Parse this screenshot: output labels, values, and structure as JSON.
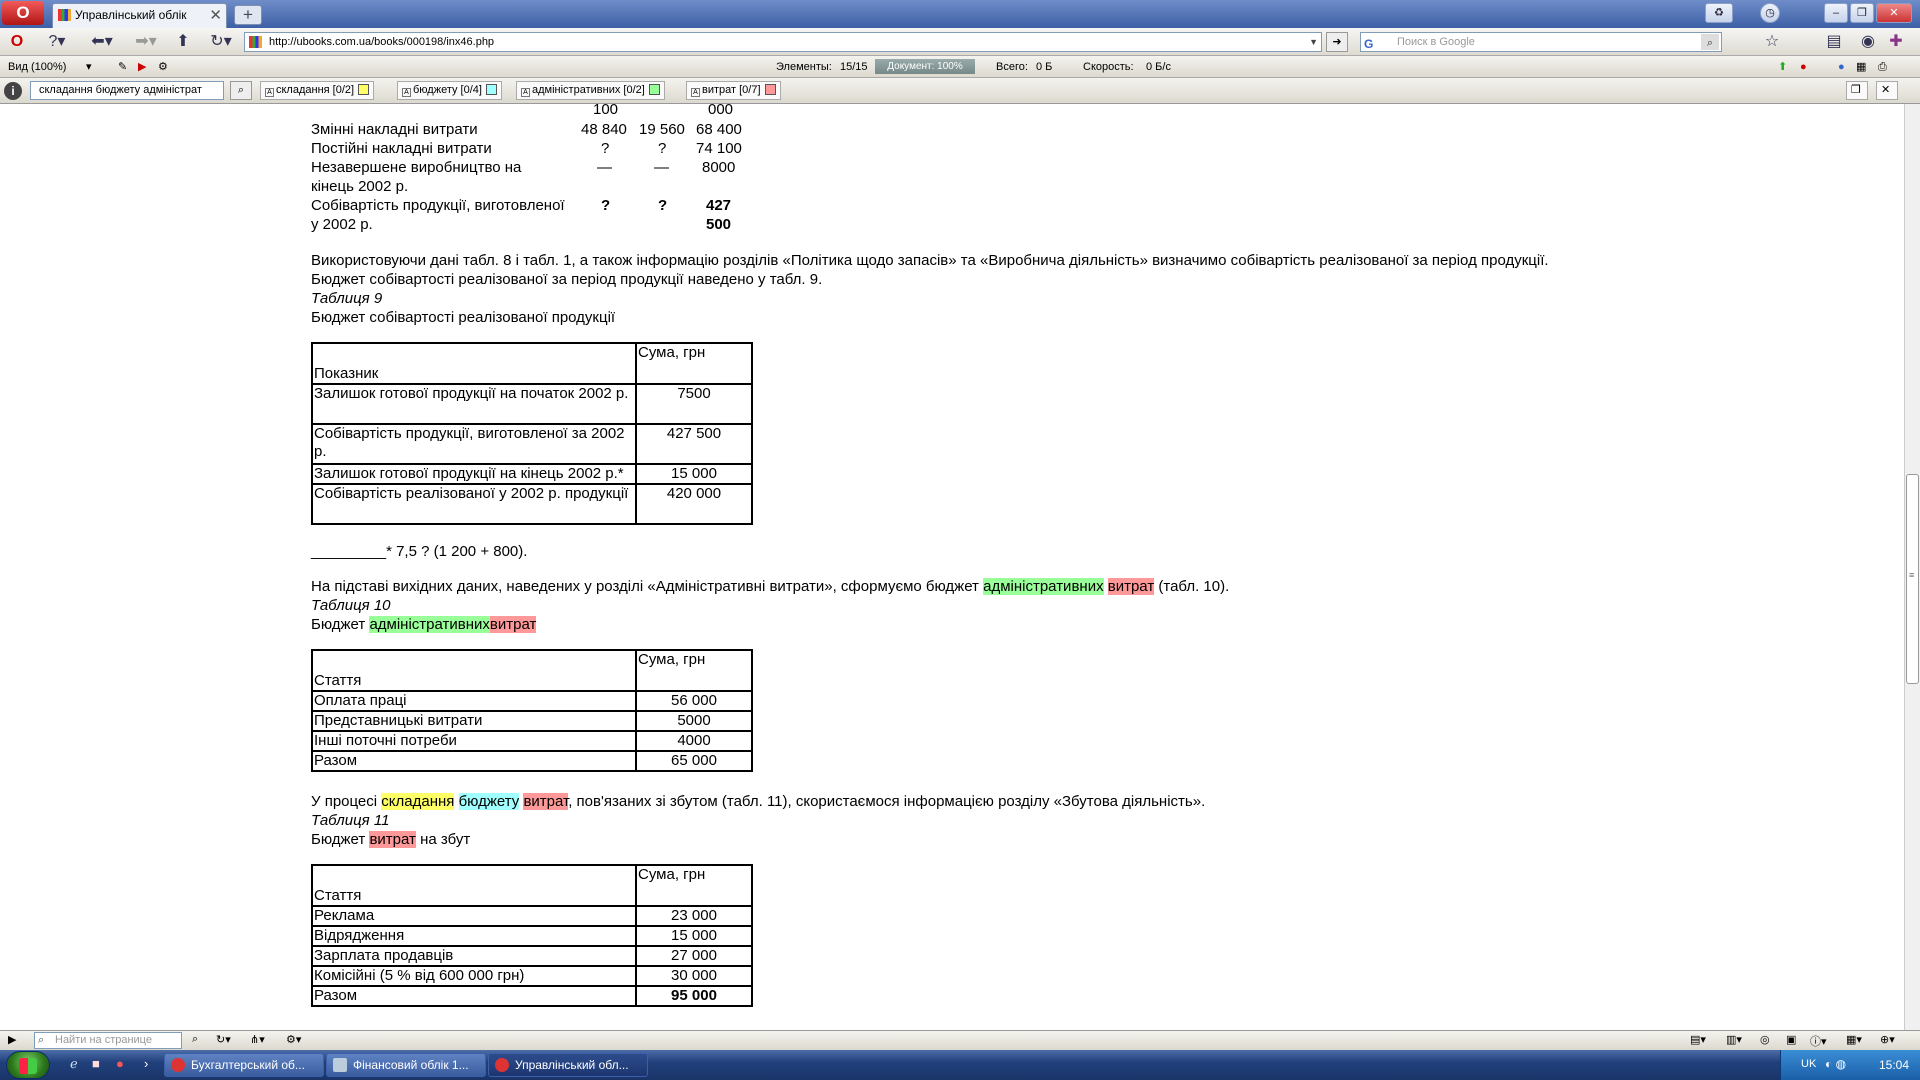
{
  "browser": {
    "tab_title": "Управлінський облік",
    "tab_close": "✕",
    "new_tab": "+",
    "url": "http://ubooks.com.ua/books/000198/inx46.php",
    "search_placeholder": "Поиск в Google",
    "search_engine_icon": "G",
    "url_dropdown": "▼",
    "go_button": "➜"
  },
  "infobar": {
    "view": "Вид (100%)",
    "elements_label": "Элементы:",
    "elements_value": "15/15",
    "document_label": "Документ: 100%",
    "document_progress": 100,
    "total_label": "Всего:",
    "total_value": "0 Б",
    "speed_label": "Скорость:",
    "speed_value": "0 Б/с"
  },
  "findbar": {
    "query": "складання бюджету адміністрат",
    "terms": [
      {
        "label": "складання [0/2]",
        "color": "#ffff66"
      },
      {
        "label": "бюджету [0/4]",
        "color": "#a0ffff"
      },
      {
        "label": "адміністративних [0/2]",
        "color": "#99ff99"
      },
      {
        "label": "витрат [0/7]",
        "color": "#ff9999"
      }
    ]
  },
  "content": {
    "prev_table": {
      "top_row": [
        "100",
        "000"
      ],
      "rows": [
        {
          "label": "Змінні накладні витрати",
          "a": "48 840",
          "b": "19 560",
          "c": "68 400"
        },
        {
          "label": "Постійні накладні витрати",
          "a": "?",
          "b": "?",
          "c": "74 100"
        },
        {
          "label": "Незавершене виробництво на",
          "label2": "кінець 2002 р.",
          "a": "—",
          "b": "—",
          "c": "8000"
        },
        {
          "label": "Собівартість продукції, виготовленої",
          "label2": "у 2002 р.",
          "a": "?",
          "b": "?",
          "c": "427",
          "c2": "500"
        }
      ]
    },
    "para1": "Використовуючи дані табл. 8 і табл. 1, а також інформацію розділів «Політика щодо запасів» та «Виробнича діяльність» визначимо собівартість реалізованої за період продукції.",
    "para1b": "Бюджет собівартості реалізованої за період продукції наведено у табл. 9.",
    "table9_caption": "Таблиця 9",
    "table9_title": "Бюджет собівартості реалізованої продукції",
    "table9": {
      "header": [
        "Показник",
        "Сума, грн"
      ],
      "rows": [
        [
          "Залишок готової продукції на початок 2002 р.",
          "7500"
        ],
        [
          "Собівартість продукції, виготовленої за 2002 р.",
          "427 500"
        ],
        [
          "Залишок готової продукції на кінець 2002 р.*",
          "15 000"
        ],
        [
          "Собівартість реалізованої у 2002 р. продукції",
          "420 000"
        ]
      ]
    },
    "footnote": "_________* 7,5 ? (1 200 + 800).",
    "para2_a": "На підставі вихідних даних, наведених у розділі «Адміністративні витрати», сформуємо бюджет",
    "para2_hl1": "адміністративних",
    "para2_hl2": "витрат",
    "para2_b": "(табл. 10).",
    "table10_caption": "Таблиця 10",
    "table10_title_a": "Бюджет",
    "table10_title_hl1": "адміністративних",
    "table10_title_hl2": "витрат",
    "table10": {
      "header": [
        "Стаття",
        "Сума, грн"
      ],
      "rows": [
        [
          "Оплата праці",
          "56 000"
        ],
        [
          "Представницькі витрати",
          "5000"
        ],
        [
          "Інші поточні потреби",
          "4000"
        ],
        [
          "Разом",
          "65 000"
        ]
      ]
    },
    "para3_a": "У процесі",
    "para3_hl1": "складання",
    "para3_hl2": "бюджету",
    "para3_hl3": "витрат",
    "para3_b": ", пов'язаних зі збутом (табл. 11), скористаємося інформацією розділу «Збутова діяльність».",
    "table11_caption": "Таблиця 11",
    "table11_title_a": "Бюджет",
    "table11_title_hl": "витрат",
    "table11_title_b": "на збут",
    "table11": {
      "header": [
        "Стаття",
        "Сума, грн"
      ],
      "rows": [
        [
          "Реклама",
          "23 000"
        ],
        [
          "Відрядження",
          "15 000"
        ],
        [
          "Зарплата продавців",
          "27 000"
        ],
        [
          "Комісійні (5 % від 600 000 грн)",
          "30 000"
        ],
        [
          "Разом",
          "95 000"
        ]
      ]
    }
  },
  "bottombar": {
    "page_find_placeholder": "Найти на странице"
  },
  "taskbar": {
    "items": [
      {
        "label": "Бухгалтерський об..."
      },
      {
        "label": "Фінансовий облік 1..."
      },
      {
        "label": "Управлінський обл..."
      }
    ],
    "lang": "UK",
    "time": "15:04"
  }
}
